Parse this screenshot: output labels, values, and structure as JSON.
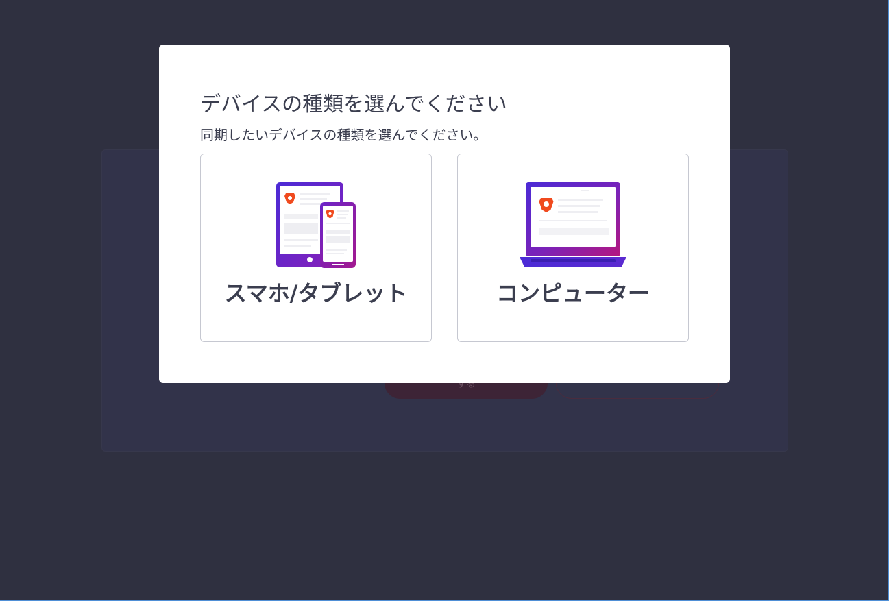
{
  "background": {
    "primary_button_label": "する"
  },
  "dialog": {
    "title": "デバイスの種類を選んでください",
    "subtitle": "同期したいデバイスの種類を選んでください。",
    "options": [
      {
        "label": "スマホ/タブレット",
        "icon": "phone-tablet-icon"
      },
      {
        "label": "コンピューター",
        "icon": "laptop-icon"
      }
    ]
  },
  "colors": {
    "backdrop": "#2f3040",
    "dialog_bg": "#ffffff",
    "text": "#3b3e4f",
    "card_border": "#c6c8d1",
    "device_gradient_start": "#4b2bd6",
    "device_gradient_end": "#a3198f",
    "brave_orange": "#f04a1e"
  }
}
